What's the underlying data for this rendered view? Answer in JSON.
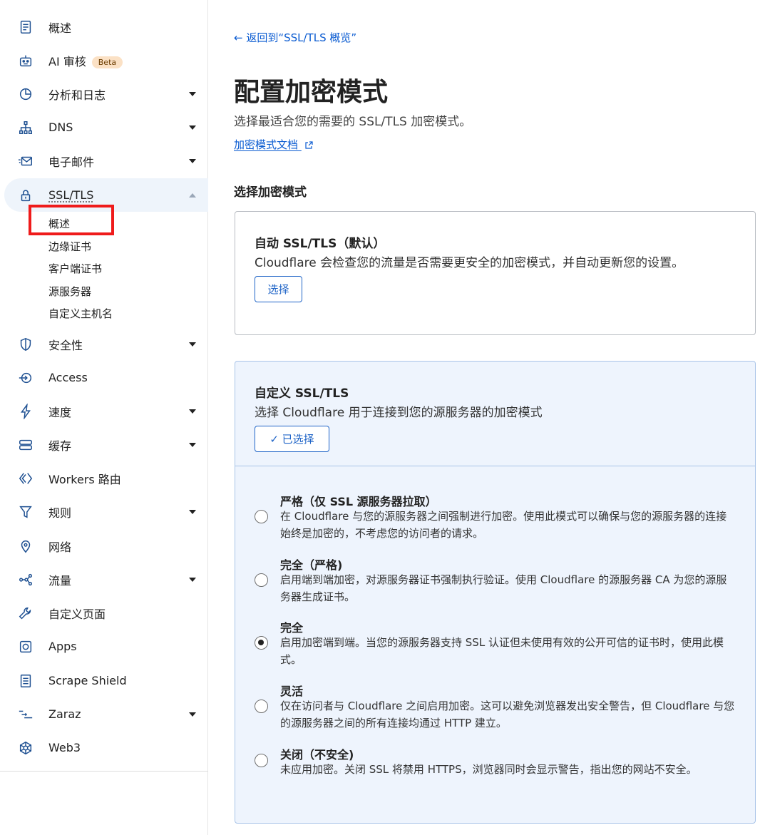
{
  "sidebar": {
    "items": [
      {
        "label": "概述",
        "icon": "document-icon",
        "caret": false
      },
      {
        "label": "AI 审核",
        "icon": "robot-icon",
        "caret": false,
        "badge": "Beta"
      },
      {
        "label": "分析和日志",
        "icon": "pie-chart-icon",
        "caret": true
      },
      {
        "label": "DNS",
        "icon": "network-icon",
        "caret": true
      },
      {
        "label": "电子邮件",
        "icon": "email-icon",
        "caret": true
      },
      {
        "label": "SSL/TLS",
        "icon": "lock-icon",
        "caret": true,
        "expanded": true
      },
      {
        "label": "安全性",
        "icon": "shield-icon",
        "caret": true
      },
      {
        "label": "Access",
        "icon": "access-icon",
        "caret": false
      },
      {
        "label": "速度",
        "icon": "lightning-icon",
        "caret": true
      },
      {
        "label": "缓存",
        "icon": "storage-icon",
        "caret": true
      },
      {
        "label": "Workers 路由",
        "icon": "workers-icon",
        "caret": false
      },
      {
        "label": "规则",
        "icon": "funnel-icon",
        "caret": true
      },
      {
        "label": "网络",
        "icon": "location-pin-icon",
        "caret": false
      },
      {
        "label": "流量",
        "icon": "traffic-icon",
        "caret": true
      },
      {
        "label": "自定义页面",
        "icon": "wrench-icon",
        "caret": false
      },
      {
        "label": "Apps",
        "icon": "apps-icon",
        "caret": false
      },
      {
        "label": "Scrape Shield",
        "icon": "scrape-icon",
        "caret": false
      },
      {
        "label": "Zaraz",
        "icon": "zaraz-icon",
        "caret": true
      },
      {
        "label": "Web3",
        "icon": "web3-icon",
        "caret": false
      }
    ],
    "ssl_sub_items": [
      "概述",
      "边缘证书",
      "客户端证书",
      "源服务器",
      "自定义主机名"
    ]
  },
  "main": {
    "back_link": "← 返回到“SSL/TLS 概览”",
    "title": "配置加密模式",
    "subtitle": "选择最适合您的需要的 SSL/TLS 加密模式。",
    "doc_link": "加密模式文档",
    "section_heading": "选择加密模式",
    "auto_card": {
      "title": "自动 SSL/TLS（默认）",
      "desc": "Cloudflare 会检查您的流量是否需要更安全的加密模式，并自动更新您的设置。",
      "button": "选择"
    },
    "custom_card": {
      "title": "自定义 SSL/TLS",
      "desc": "选择 Cloudflare 用于连接到您的源服务器的加密模式",
      "button": "✓ 已选择",
      "options": [
        {
          "title": "严格（仅 SSL 源服务器拉取）",
          "desc": "在 Cloudflare 与您的源服务器之间强制进行加密。使用此模式可以确保与您的源服务器的连接始终是加密的，不考虑您的访问者的请求。",
          "checked": false
        },
        {
          "title": "完全（严格)",
          "desc": "启用端到端加密，对源服务器证书强制执行验证。使用 Cloudflare 的源服务器 CA 为您的源服务器生成证书。",
          "checked": false
        },
        {
          "title": "完全",
          "desc": "启用加密端到端。当您的源服务器支持 SSL 认证但未使用有效的公开可信的证书时，使用此模式。",
          "checked": true
        },
        {
          "title": "灵活",
          "desc": "仅在访问者与 Cloudflare 之间启用加密。这可以避免浏览器发出安全警告，但 Cloudflare 与您的源服务器之间的所有连接均通过 HTTP 建立。",
          "checked": false
        },
        {
          "title": "关闭（不安全)",
          "desc": "未应用加密。关闭 SSL 将禁用 HTTPS，浏览器同时会显示警告，指出您的网站不安全。",
          "checked": false
        }
      ]
    }
  },
  "colors": {
    "link": "#0a5bd1",
    "highlight_box": "#ef1b1b",
    "custom_card_bg": "#eef4fd"
  }
}
